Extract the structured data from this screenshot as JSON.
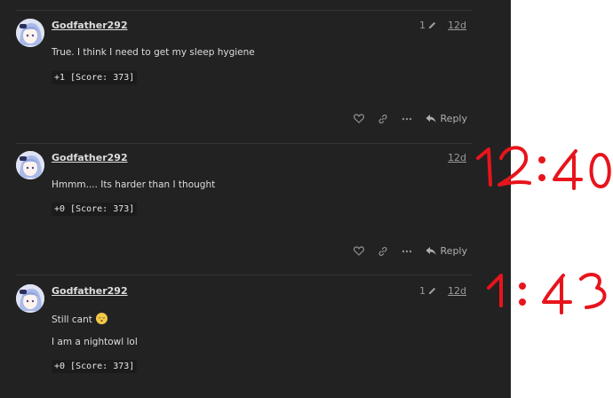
{
  "posts": [
    {
      "username": "Godfather292",
      "edit_count": "1",
      "date": "12d",
      "paragraphs": [
        "True. I think I need to get my sleep hygiene"
      ],
      "score": "+1 [Score: 373]",
      "reply_label": "Reply"
    },
    {
      "username": "Godfather292",
      "edit_count": "",
      "date": "12d",
      "paragraphs": [
        "Hmmm.... Its harder than I thought"
      ],
      "score": "+0 [Score: 373]",
      "reply_label": "Reply"
    },
    {
      "username": "Godfather292",
      "edit_count": "1",
      "date": "12d",
      "paragraphs": [
        "Still cant",
        "I am a nightowl lol"
      ],
      "emoji": "sleepy-face-emoji",
      "score": "+0 [Score: 373]",
      "reply_label": "Reply"
    }
  ],
  "annotations": {
    "first": "12:40",
    "second": "1:43",
    "color": "#e8141c"
  },
  "colors": {
    "background": "#222222",
    "text": "#dddddd",
    "muted": "#9a9a9a"
  }
}
